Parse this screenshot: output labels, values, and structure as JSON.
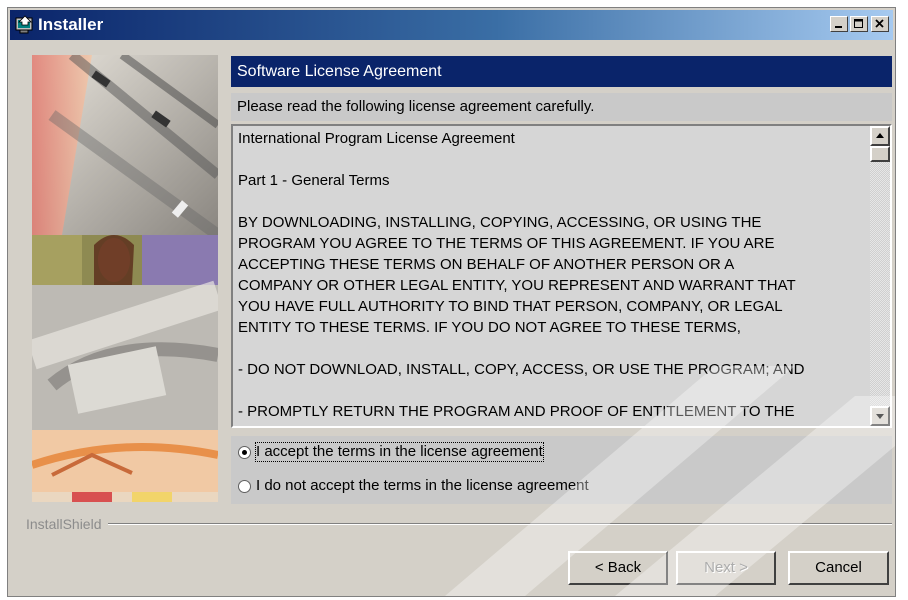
{
  "window": {
    "title": "Installer"
  },
  "header": {
    "title": "Software License Agreement"
  },
  "instruction": "Please read the following license agreement carefully.",
  "license": {
    "paragraphs": [
      "International Program License Agreement",
      "Part 1 - General Terms",
      "BY DOWNLOADING, INSTALLING, COPYING, ACCESSING, OR USING THE\nPROGRAM YOU AGREE TO THE TERMS OF THIS AGREEMENT. IF YOU ARE\nACCEPTING THESE TERMS ON BEHALF OF ANOTHER PERSON OR A\nCOMPANY OR OTHER LEGAL ENTITY, YOU REPRESENT AND WARRANT THAT\nYOU HAVE FULL AUTHORITY TO BIND THAT PERSON, COMPANY, OR LEGAL\nENTITY TO THESE TERMS. IF YOU DO NOT AGREE TO THESE TERMS,",
      "- DO NOT DOWNLOAD, INSTALL, COPY, ACCESS, OR USE THE PROGRAM; AND",
      "- PROMPTLY RETURN THE PROGRAM AND PROOF OF ENTITLEMENT TO THE"
    ]
  },
  "options": {
    "accept": {
      "label": "I accept the terms in the license agreement",
      "selected": true
    },
    "decline": {
      "label": "I do not accept the terms in the license agreement",
      "selected": false
    }
  },
  "branding": "InstallShield",
  "buttons": {
    "back": "< Back",
    "next": "Next >",
    "cancel": "Cancel"
  },
  "colors": {
    "titlebar": "#0a246a",
    "header": "#0a246a",
    "face": "#d4d0c8"
  }
}
